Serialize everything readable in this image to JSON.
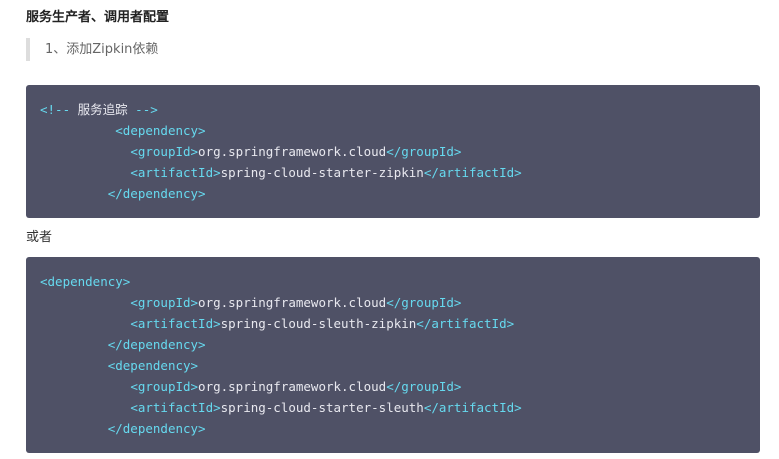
{
  "heading": "服务生产者、调用者配置",
  "quote": "1、添加Zipkin依赖",
  "or_text": "或者",
  "colors": {
    "code_bg": "#4f5166",
    "tag": "#66d9ef",
    "text": "#e8e8ef",
    "quote_border": "#dddddd"
  },
  "code_block_1": [
    {
      "indent": "",
      "parts": [
        [
          "comment",
          "<!-- "
        ],
        [
          "comment-text",
          "服务追踪"
        ],
        [
          "comment",
          " -->"
        ]
      ]
    },
    {
      "indent": "          ",
      "parts": [
        [
          "tag",
          "<dependency>"
        ]
      ]
    },
    {
      "indent": "            ",
      "parts": [
        [
          "tag",
          "<groupId>"
        ],
        [
          "txt",
          "org.springframework.cloud"
        ],
        [
          "tag",
          "</groupId>"
        ]
      ]
    },
    {
      "indent": "            ",
      "parts": [
        [
          "tag",
          "<artifactId>"
        ],
        [
          "txt",
          "spring-cloud-starter-zipkin"
        ],
        [
          "tag",
          "</artifactId>"
        ]
      ]
    },
    {
      "indent": "         ",
      "parts": [
        [
          "tag",
          "</dependency>"
        ]
      ]
    }
  ],
  "code_block_2": [
    {
      "indent": "",
      "parts": [
        [
          "tag",
          "<dependency>"
        ]
      ]
    },
    {
      "indent": "            ",
      "parts": [
        [
          "tag",
          "<groupId>"
        ],
        [
          "txt",
          "org.springframework.cloud"
        ],
        [
          "tag",
          "</groupId>"
        ]
      ]
    },
    {
      "indent": "            ",
      "parts": [
        [
          "tag",
          "<artifactId>"
        ],
        [
          "txt",
          "spring-cloud-sleuth-zipkin"
        ],
        [
          "tag",
          "</artifactId>"
        ]
      ]
    },
    {
      "indent": "         ",
      "parts": [
        [
          "tag",
          "</dependency>"
        ]
      ]
    },
    {
      "indent": "         ",
      "parts": [
        [
          "tag",
          "<dependency>"
        ]
      ]
    },
    {
      "indent": "            ",
      "parts": [
        [
          "tag",
          "<groupId>"
        ],
        [
          "txt",
          "org.springframework.cloud"
        ],
        [
          "tag",
          "</groupId>"
        ]
      ]
    },
    {
      "indent": "            ",
      "parts": [
        [
          "tag",
          "<artifactId>"
        ],
        [
          "txt",
          "spring-cloud-starter-sleuth"
        ],
        [
          "tag",
          "</artifactId>"
        ]
      ]
    },
    {
      "indent": "         ",
      "parts": [
        [
          "tag",
          "</dependency>"
        ]
      ]
    }
  ]
}
